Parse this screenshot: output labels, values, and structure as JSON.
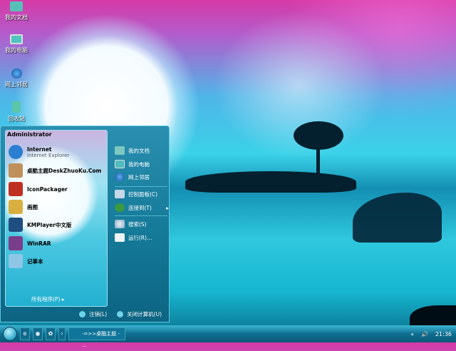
{
  "desktop_icons": [
    {
      "label": "我的文档"
    },
    {
      "label": "我的电脑"
    },
    {
      "label": "网上邻居"
    },
    {
      "label": "回收站"
    }
  ],
  "start_menu": {
    "user": "Administrator",
    "programs": [
      {
        "label": "Internet",
        "sub": "Internet Explorer",
        "icon": "ie-icon",
        "color": "#2a7fd0"
      },
      {
        "label": "桌酷主题DeskZhuoKu.Com",
        "icon": "theme-icon",
        "color": "#c0905a"
      },
      {
        "label": "IconPackager",
        "icon": "iconpackager-icon",
        "color": "#c03020"
      },
      {
        "label": "画图",
        "icon": "paint-icon",
        "color": "#d9b040"
      },
      {
        "label": "KMPlayer中文版",
        "icon": "kmplayer-icon",
        "color": "#1f4f80"
      },
      {
        "label": "WinRAR",
        "icon": "winrar-icon",
        "color": "#7a3d8a"
      },
      {
        "label": "记事本",
        "icon": "notepad-icon",
        "color": "#8ec6e6"
      }
    ],
    "all_programs": "所有程序(P)",
    "places": [
      {
        "label": "我的文档",
        "icon": "documents-icon"
      },
      {
        "label": "我的电脑",
        "icon": "computer-icon"
      },
      {
        "label": "网上邻居",
        "icon": "network-icon"
      }
    ],
    "settings": [
      {
        "label": "控制面板(C)",
        "icon": "control-panel-icon"
      },
      {
        "label": "连接到(T)",
        "icon": "connect-icon",
        "arrow": "▸"
      }
    ],
    "tools": [
      {
        "label": "搜索(S)",
        "icon": "search-icon"
      },
      {
        "label": "运行(R)...",
        "icon": "run-icon"
      }
    ],
    "logoff": "注销(L)",
    "shutdown": "关闭计算机(U)"
  },
  "taskbar": {
    "quicklaunch": [
      "e",
      "◉",
      "✿",
      "›"
    ],
    "task": "-=>>桌酷主题 - ...",
    "tray_chevron": "«",
    "clock": "21:36"
  }
}
